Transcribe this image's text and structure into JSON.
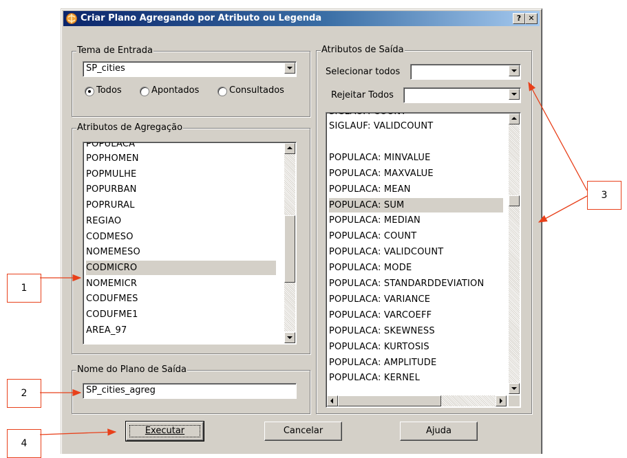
{
  "dialog": {
    "title": "Criar Plano Agregando por Atributo ou Legenda",
    "help_glyph": "?",
    "close_glyph": "✕"
  },
  "input_theme": {
    "legend": "Tema de Entrada",
    "selected": "SP_cities",
    "radios": [
      {
        "label": "Todos",
        "checked": true
      },
      {
        "label": "Apontados",
        "checked": false
      },
      {
        "label": "Consultados",
        "checked": false
      }
    ]
  },
  "aggregation": {
    "legend": "Atributos de Agregação",
    "partial_top": "POPULACA",
    "items": [
      "POPHOMEN",
      "POPMULHE",
      "POPURBAN",
      "POPRURAL",
      "REGIAO",
      "CODMESO",
      "NOMEMESO",
      "CODMICRO",
      "NOMEMICR",
      "CODUFMES",
      "CODUFME1",
      "AREA_97"
    ],
    "selected": "CODMICRO"
  },
  "output_plan": {
    "legend": "Nome do Plano de Saída",
    "value": "SP_cities_agreg"
  },
  "output_attrs": {
    "legend": "Atributos de Saída",
    "select_all_label": "Selecionar todos",
    "select_all_value": "",
    "reject_all_label": "Rejeitar Todos",
    "reject_all_value": "",
    "partial_top": "SIGLAUF: COUNT",
    "items": [
      "SIGLAUF: VALIDCOUNT",
      "",
      "POPULACA: MINVALUE",
      "POPULACA: MAXVALUE",
      "POPULACA: MEAN",
      "POPULACA: SUM",
      "POPULACA: MEDIAN",
      "POPULACA: COUNT",
      "POPULACA: VALIDCOUNT",
      "POPULACA: MODE",
      "POPULACA: STANDARDDEVIATION",
      "POPULACA: VARIANCE",
      "POPULACA: VARCOEFF",
      "POPULACA: SKEWNESS",
      "POPULACA: KURTOSIS",
      "POPULACA: AMPLITUDE",
      "POPULACA: KERNEL"
    ],
    "selected": "POPULACA: SUM"
  },
  "buttons": {
    "execute": "Executar",
    "cancel": "Cancelar",
    "help": "Ajuda"
  },
  "callouts": [
    "1",
    "2",
    "3",
    "4"
  ],
  "colors": {
    "title_start": "#0a246a",
    "title_end": "#a6caf0",
    "face": "#d4d0c8",
    "callout_border": "#e8401a"
  }
}
